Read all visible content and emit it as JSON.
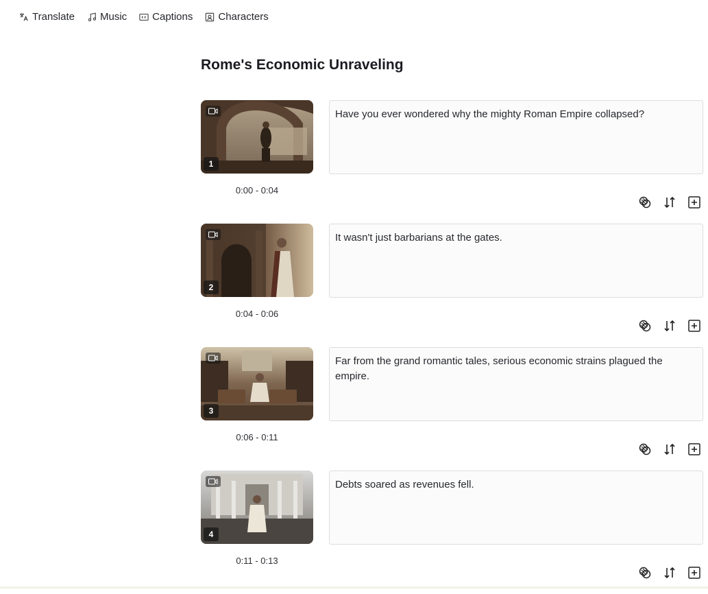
{
  "toolbar": {
    "items": [
      {
        "label": "Translate",
        "icon": "translate-icon"
      },
      {
        "label": "Music",
        "icon": "music-note-icon"
      },
      {
        "label": "Captions",
        "icon": "captions-icon"
      },
      {
        "label": "Characters",
        "icon": "portrait-icon"
      }
    ]
  },
  "page": {
    "title": "Rome's Economic Unraveling"
  },
  "scenes": [
    {
      "number": "1",
      "time": "0:00 - 0:04",
      "text": "Have you ever wondered why the mighty Roman Empire collapsed?"
    },
    {
      "number": "2",
      "time": "0:04 - 0:06",
      "text": "It wasn't just barbarians at the gates."
    },
    {
      "number": "3",
      "time": "0:06 - 0:11",
      "text": "Far from the grand romantic tales, serious economic strains plagued the empire."
    },
    {
      "number": "4",
      "time": "0:11 - 0:13",
      "text": "Debts soared as revenues fell."
    }
  ],
  "scene_actions": [
    "merge-icon",
    "reorder-icon",
    "add-scene-icon"
  ]
}
